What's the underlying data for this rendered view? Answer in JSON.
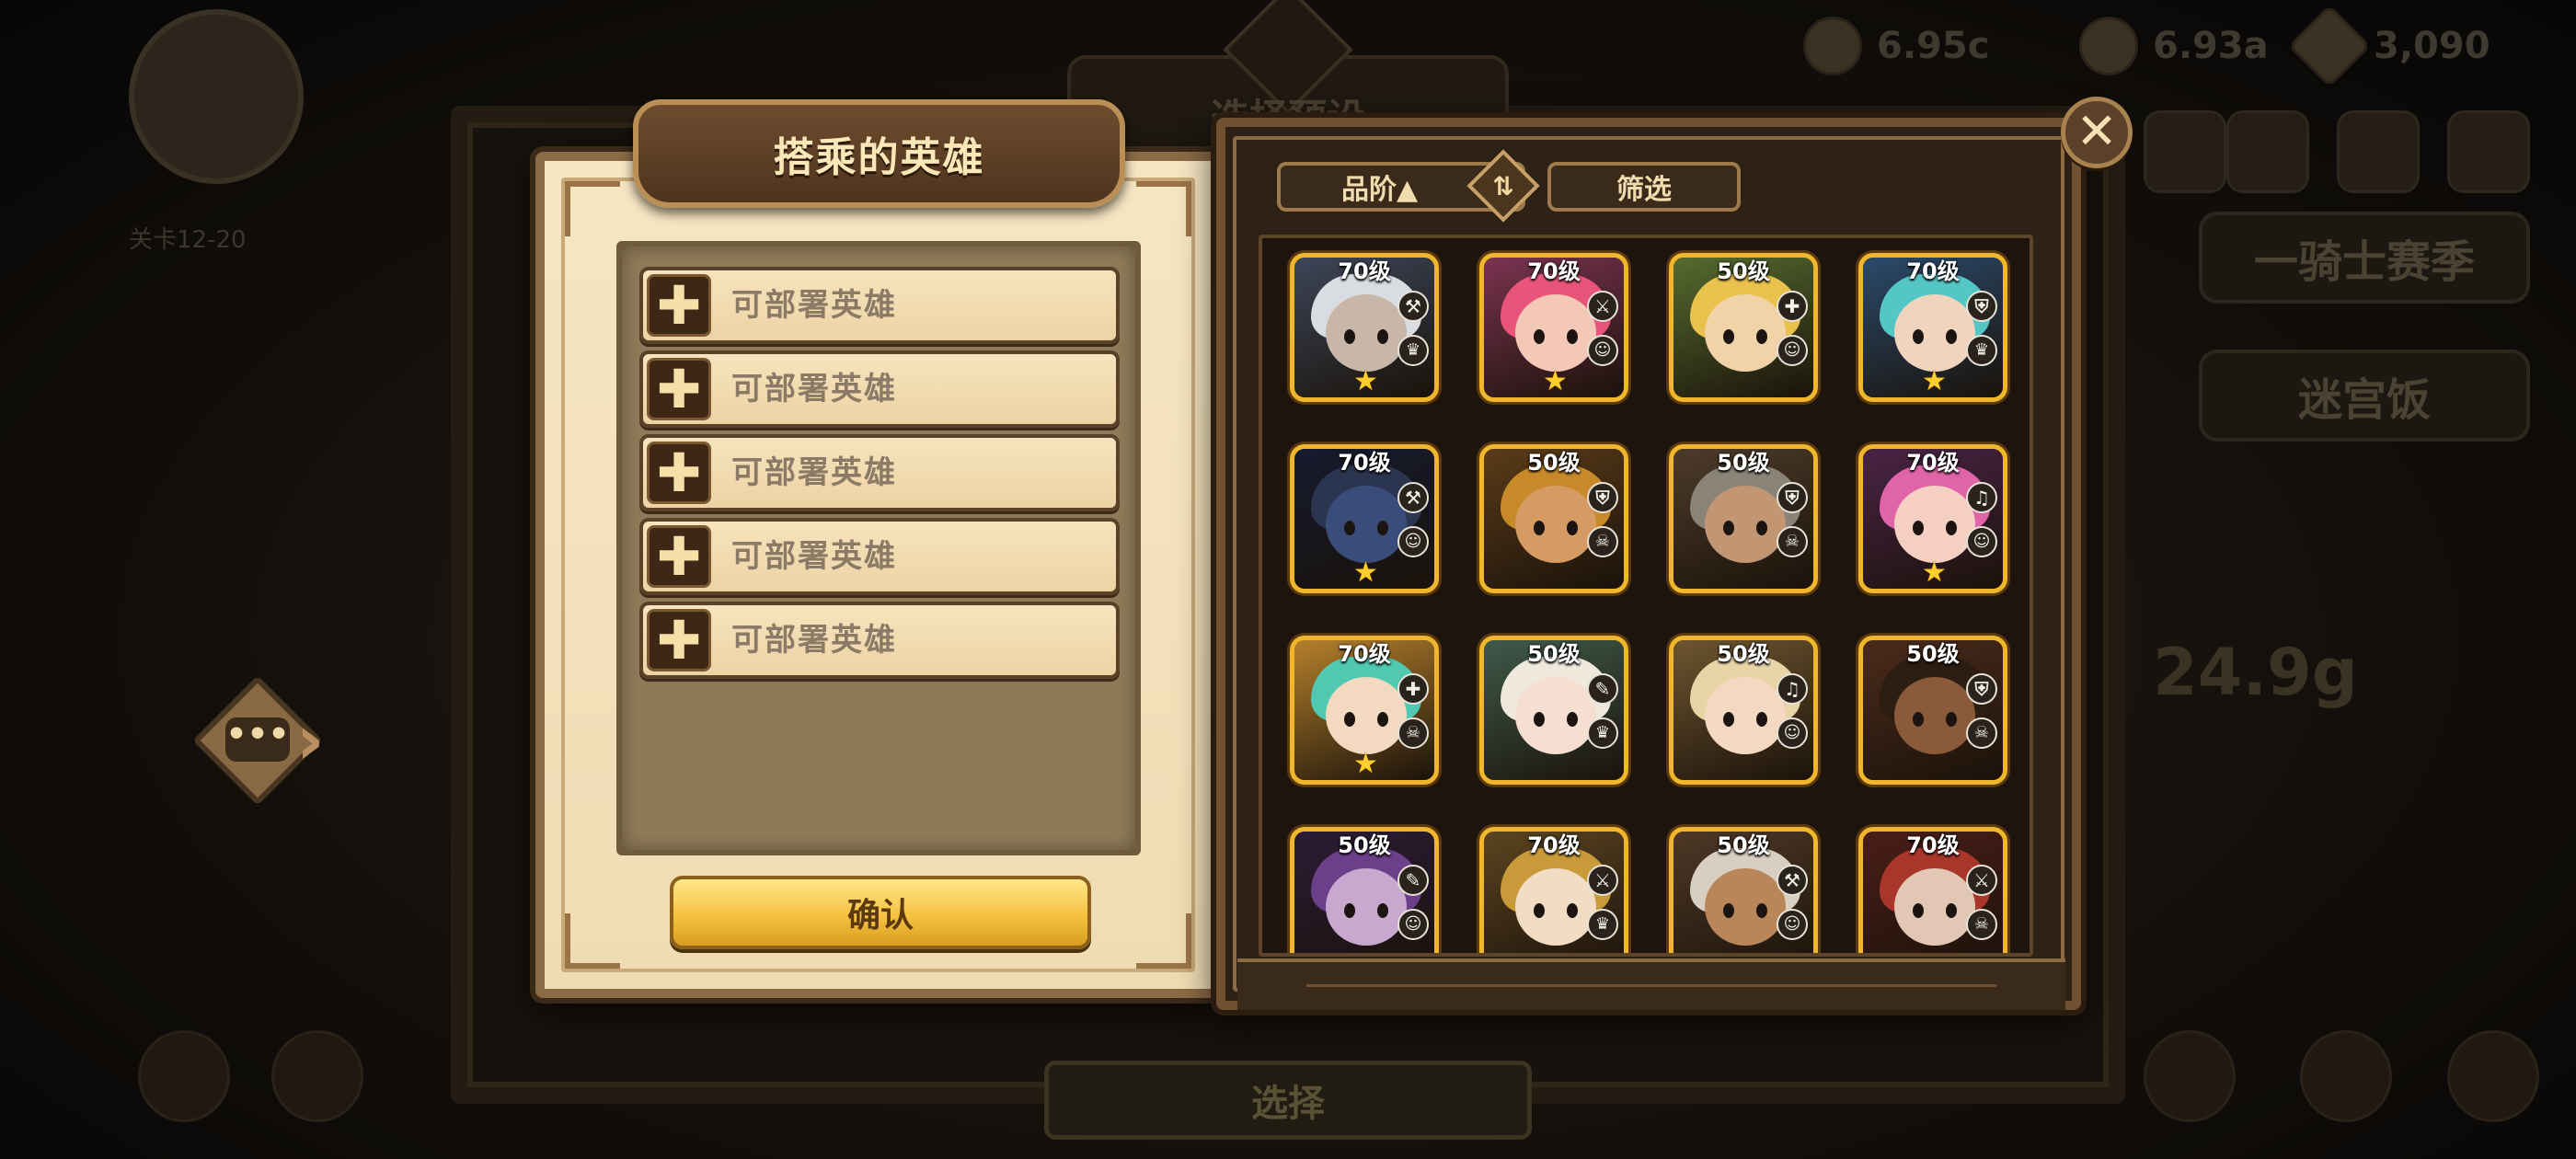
{
  "dialog": {
    "title": "搭乘的英雄",
    "slots": [
      {
        "label": "可部署英雄"
      },
      {
        "label": "可部署英雄"
      },
      {
        "label": "可部署英雄"
      },
      {
        "label": "可部署英雄"
      },
      {
        "label": "可部署英雄"
      }
    ],
    "confirm_label": "确认",
    "plus_glyph": "✚"
  },
  "hero_list": {
    "sort_label": "品阶▲",
    "filter_label": "筛选",
    "close_glyph": "✕",
    "heroes": [
      {
        "level": "70级",
        "class": "axe",
        "role": "hat",
        "stars": 1,
        "hair": "#d9dde2",
        "skin": "#c8b7a8",
        "bg": "#3d4558"
      },
      {
        "level": "70级",
        "class": "sword",
        "role": "cat",
        "stars": 1,
        "hair": "#e8557a",
        "skin": "#f3c8b6",
        "bg": "#7b3350"
      },
      {
        "level": "50级",
        "class": "cross",
        "role": "cat",
        "stars": 0,
        "hair": "#e9c24e",
        "skin": "#f2d3a8",
        "bg": "#556b2f"
      },
      {
        "level": "70级",
        "class": "shield",
        "role": "hat",
        "stars": 1,
        "hair": "#55c6c6",
        "skin": "#f1d4be",
        "bg": "#2a4a6b"
      },
      {
        "level": "70级",
        "class": "axe",
        "role": "cat",
        "stars": 1,
        "hair": "#2c3550",
        "skin": "#3a4d7a",
        "bg": "#151a2e"
      },
      {
        "level": "50级",
        "class": "shield",
        "role": "skull",
        "stars": 0,
        "hair": "#c8892b",
        "skin": "#d59b62",
        "bg": "#5a3b18"
      },
      {
        "level": "50级",
        "class": "shield",
        "role": "skull",
        "stars": 0,
        "hair": "#8a8478",
        "skin": "#c29573",
        "bg": "#4d3b2a"
      },
      {
        "level": "70级",
        "class": "lyre",
        "role": "cat",
        "stars": 1,
        "hair": "#e065a8",
        "skin": "#f4cfc2",
        "bg": "#4a2346"
      },
      {
        "level": "70级",
        "class": "cross",
        "role": "skull",
        "stars": 1,
        "hair": "#4fc9b1",
        "skin": "#f3d9bf",
        "bg": "#b5802c"
      },
      {
        "level": "50级",
        "class": "book",
        "role": "hat",
        "stars": 0,
        "hair": "#efe8dc",
        "skin": "#f6dfd0",
        "bg": "#3f5a4a"
      },
      {
        "level": "50级",
        "class": "lyre",
        "role": "cat",
        "stars": 0,
        "hair": "#e9d4a8",
        "skin": "#f4d9c2",
        "bg": "#6e5530"
      },
      {
        "level": "50级",
        "class": "shield",
        "role": "skull",
        "stars": 0,
        "hair": "#2b1d12",
        "skin": "#8a5a3a",
        "bg": "#4b2b1a"
      },
      {
        "level": "50级",
        "class": "book",
        "role": "cat",
        "stars": 0,
        "hair": "#6c3f8a",
        "skin": "#c9a8d0",
        "bg": "#2c1b35"
      },
      {
        "level": "70级",
        "class": "sword",
        "role": "hat",
        "stars": 0,
        "hair": "#c89a3a",
        "skin": "#f3dcc4",
        "bg": "#5c4420"
      },
      {
        "level": "50级",
        "class": "axe",
        "role": "cat",
        "stars": 0,
        "hair": "#d8cfc2",
        "skin": "#b98659",
        "bg": "#4e3826"
      },
      {
        "level": "70级",
        "class": "sword",
        "role": "skull",
        "stars": 0,
        "hair": "#a8362a",
        "skin": "#e2c7b4",
        "bg": "#4a1e17"
      }
    ]
  },
  "background_hud": {
    "preset_title": "选择预设",
    "select_label": "选择",
    "stage_text": "关卡12-20",
    "resource_1": "6.93a",
    "resource_2": "6.95c",
    "gems": "3,090",
    "gold_big": "24.9g",
    "banner_1": "一骑士赛季",
    "banner_2": "迷宫饭"
  },
  "colors": {
    "parchment": "#f1ddb6",
    "frame_brown": "#8b6a46",
    "gold_accent": "#f0b62c",
    "confirm_yellow": "#f5c241",
    "title_text": "#fbe7b8"
  }
}
